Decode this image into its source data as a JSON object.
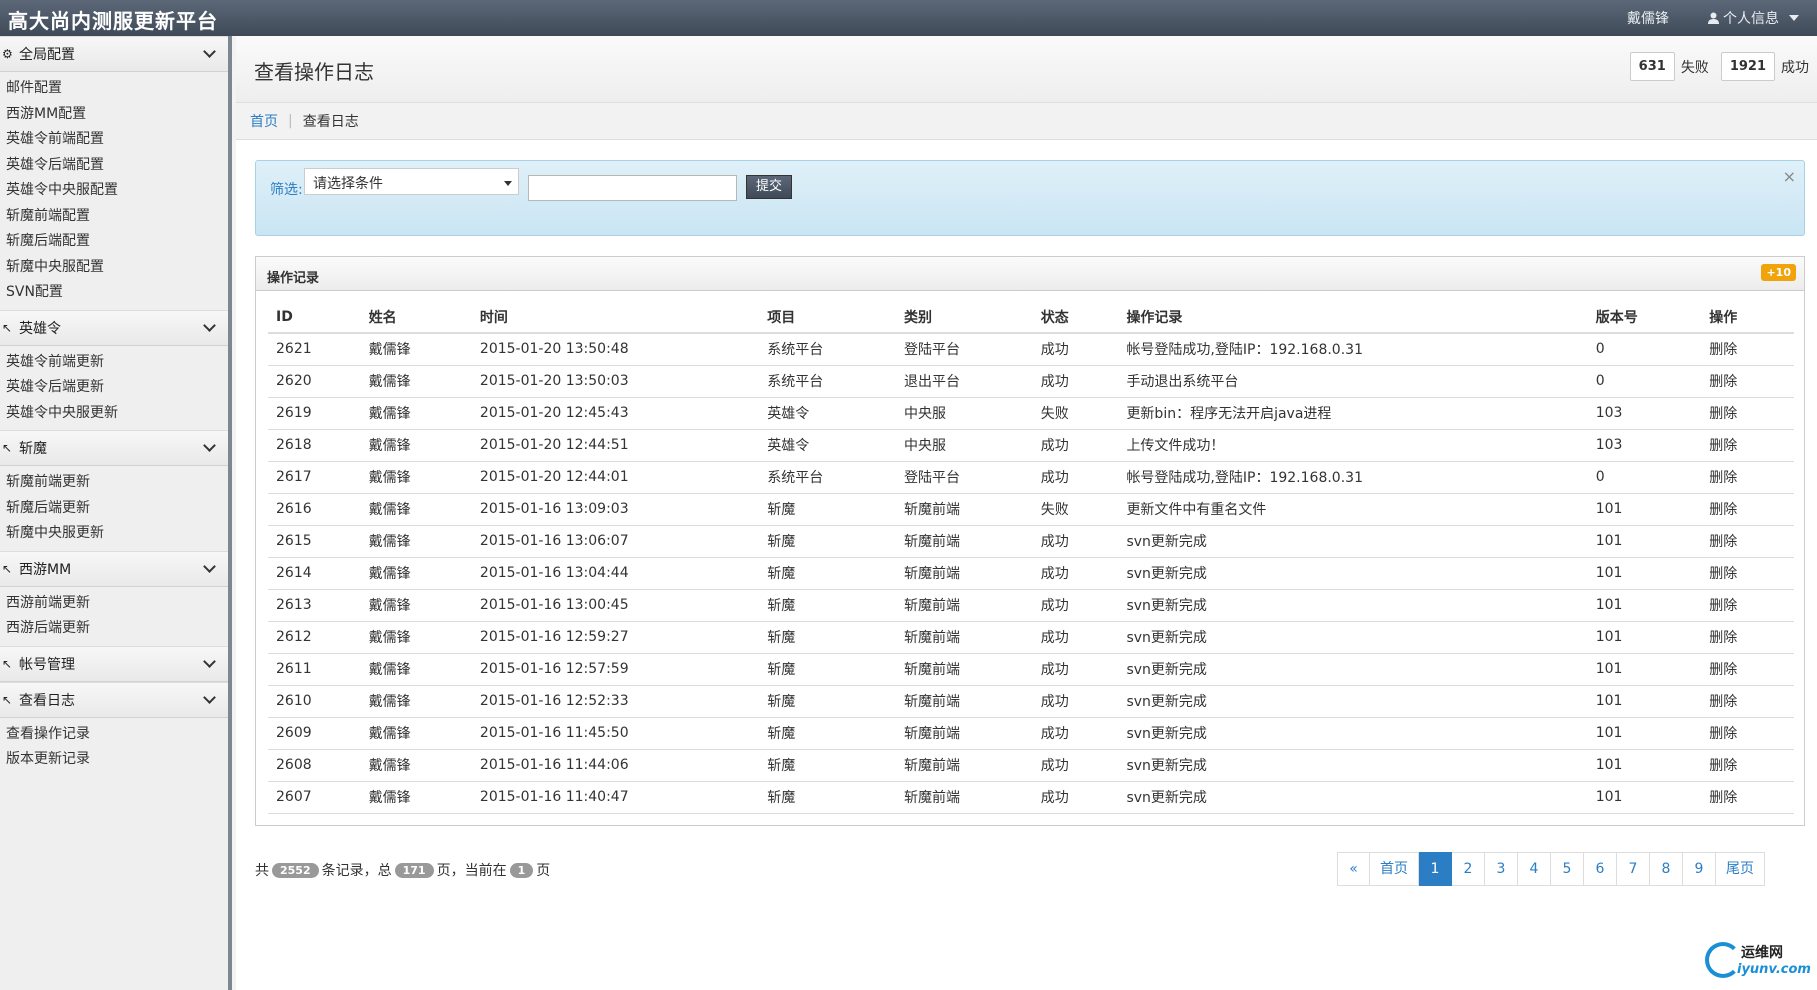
{
  "app": {
    "title": "高大尚内测服更新平台"
  },
  "topbar": {
    "user_name": "戴儒锋",
    "profile_label": "个人信息"
  },
  "sidebar": {
    "sections": [
      {
        "title": "全局配置",
        "items": [
          "邮件配置",
          "西游MM配置",
          "英雄令前端配置",
          "英雄令后端配置",
          "英雄令中央服配置",
          "斩魔前端配置",
          "斩魔后端配置",
          "斩魔中央服配置",
          "SVN配置"
        ]
      },
      {
        "title": "英雄令",
        "items": [
          "英雄令前端更新",
          "英雄令后端更新",
          "英雄令中央服更新"
        ]
      },
      {
        "title": "斩魔",
        "items": [
          "斩魔前端更新",
          "斩魔后端更新",
          "斩魔中央服更新"
        ]
      },
      {
        "title": "西游MM",
        "items": [
          "西游前端更新",
          "西游后端更新"
        ]
      },
      {
        "title": "帐号管理",
        "items": []
      },
      {
        "title": "查看日志",
        "items": [
          "查看操作记录",
          "版本更新记录"
        ]
      }
    ]
  },
  "header": {
    "title": "查看操作日志",
    "fail_count": "631",
    "fail_label": "失败",
    "success_count": "1921",
    "success_label": "成功"
  },
  "breadcrumb": {
    "home": "首页",
    "current": "查看日志"
  },
  "filter": {
    "label": "筛选:",
    "select_value": "请选择条件",
    "input_value": "",
    "submit_label": "提交",
    "close": "×"
  },
  "panel": {
    "title": "操作记录",
    "badge": "+10"
  },
  "table": {
    "columns": [
      "ID",
      "姓名",
      "时间",
      "项目",
      "类别",
      "状态",
      "操作记录",
      "版本号",
      "操作"
    ],
    "rows": [
      [
        "2621",
        "戴儒锋",
        "2015-01-20 13:50:48",
        "系统平台",
        "登陆平台",
        "成功",
        "帐号登陆成功,登陆IP：192.168.0.31",
        "0",
        "删除"
      ],
      [
        "2620",
        "戴儒锋",
        "2015-01-20 13:50:03",
        "系统平台",
        "退出平台",
        "成功",
        "手动退出系统平台",
        "0",
        "删除"
      ],
      [
        "2619",
        "戴儒锋",
        "2015-01-20 12:45:43",
        "英雄令",
        "中央服",
        "失败",
        "更新bin：程序无法开启java进程",
        "103",
        "删除"
      ],
      [
        "2618",
        "戴儒锋",
        "2015-01-20 12:44:51",
        "英雄令",
        "中央服",
        "成功",
        "上传文件成功！",
        "103",
        "删除"
      ],
      [
        "2617",
        "戴儒锋",
        "2015-01-20 12:44:01",
        "系统平台",
        "登陆平台",
        "成功",
        "帐号登陆成功,登陆IP：192.168.0.31",
        "0",
        "删除"
      ],
      [
        "2616",
        "戴儒锋",
        "2015-01-16 13:09:03",
        "斩魔",
        "斩魔前端",
        "失败",
        "更新文件中有重名文件",
        "101",
        "删除"
      ],
      [
        "2615",
        "戴儒锋",
        "2015-01-16 13:06:07",
        "斩魔",
        "斩魔前端",
        "成功",
        "svn更新完成",
        "101",
        "删除"
      ],
      [
        "2614",
        "戴儒锋",
        "2015-01-16 13:04:44",
        "斩魔",
        "斩魔前端",
        "成功",
        "svn更新完成",
        "101",
        "删除"
      ],
      [
        "2613",
        "戴儒锋",
        "2015-01-16 13:00:45",
        "斩魔",
        "斩魔前端",
        "成功",
        "svn更新完成",
        "101",
        "删除"
      ],
      [
        "2612",
        "戴儒锋",
        "2015-01-16 12:59:27",
        "斩魔",
        "斩魔前端",
        "成功",
        "svn更新完成",
        "101",
        "删除"
      ],
      [
        "2611",
        "戴儒锋",
        "2015-01-16 12:57:59",
        "斩魔",
        "斩魔前端",
        "成功",
        "svn更新完成",
        "101",
        "删除"
      ],
      [
        "2610",
        "戴儒锋",
        "2015-01-16 12:52:33",
        "斩魔",
        "斩魔前端",
        "成功",
        "svn更新完成",
        "101",
        "删除"
      ],
      [
        "2609",
        "戴儒锋",
        "2015-01-16 11:45:50",
        "斩魔",
        "斩魔前端",
        "成功",
        "svn更新完成",
        "101",
        "删除"
      ],
      [
        "2608",
        "戴儒锋",
        "2015-01-16 11:44:06",
        "斩魔",
        "斩魔前端",
        "成功",
        "svn更新完成",
        "101",
        "删除"
      ],
      [
        "2607",
        "戴儒锋",
        "2015-01-16 11:40:47",
        "斩魔",
        "斩魔前端",
        "成功",
        "svn更新完成",
        "101",
        "删除"
      ]
    ]
  },
  "footer": {
    "prefix": "共",
    "total_records": "2552",
    "records_label": "条记录，总",
    "total_pages": "171",
    "pages_label": "页，当前在",
    "current_page": "1",
    "page_suffix": "页"
  },
  "pagination": [
    "«",
    "首页",
    "1",
    "2",
    "3",
    "4",
    "5",
    "6",
    "7",
    "8",
    "9",
    "尾页"
  ],
  "pagination_active": "1",
  "watermark": {
    "top": "运维网",
    "bottom": "iyunv.com"
  },
  "colors": {
    "accent": "#2c7ec4",
    "fail": "#c0392b",
    "topbar": "#4a5564",
    "badge": "#f0a30a"
  }
}
